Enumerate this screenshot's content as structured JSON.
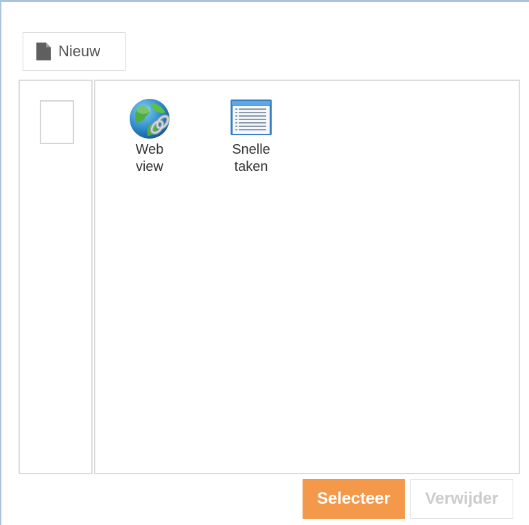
{
  "toolbar": {
    "new_label": "Nieuw",
    "new_icon": "document-icon"
  },
  "tiles": [
    {
      "label": "Web\nview",
      "icon": "globe-link-icon"
    },
    {
      "label": "Snelle\ntaken",
      "icon": "list-window-icon"
    }
  ],
  "footer": {
    "select_label": "Selecteer",
    "delete_label": "Verwijder"
  },
  "colors": {
    "accent": "#f4994a",
    "frame_border": "#a9c4de",
    "pane_border": "#dcdcdc",
    "disabled_text": "#cccccc"
  }
}
